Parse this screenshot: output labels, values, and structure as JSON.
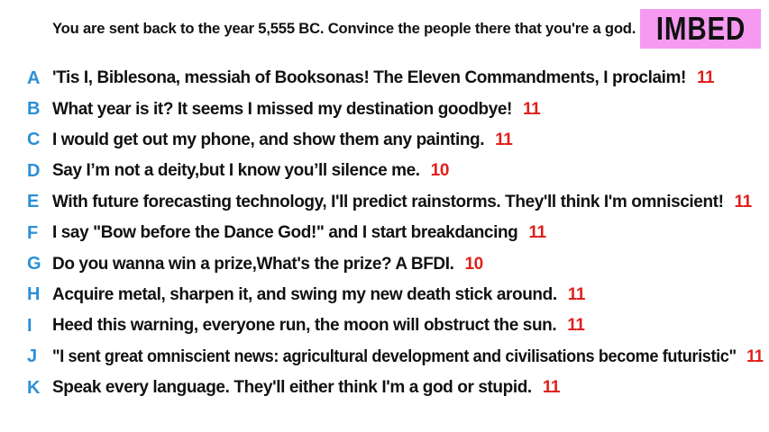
{
  "prompt": "You are sent back to the year 5,555 BC. Convince the people there that you're a god.",
  "logo": {
    "text": "IMBED",
    "background": "#f59af0"
  },
  "colors": {
    "letter": "#2c8fd6",
    "score": "#e0201b",
    "text": "#111111"
  },
  "answers": [
    {
      "letter": "A",
      "text": "'Tis I, Biblesona, messiah of Booksonas! The Eleven Commandments, I proclaim!",
      "score": "11"
    },
    {
      "letter": "B",
      "text": "What year is it? It seems I missed my destination goodbye!",
      "score": "11"
    },
    {
      "letter": "C",
      "text": "I would get out my phone, and show them any painting.",
      "score": "11"
    },
    {
      "letter": "D",
      "text": "Say I’m not a deity,but I know you’ll silence me.",
      "score": "10"
    },
    {
      "letter": "E",
      "text": "With future forecasting technology, I'll predict rainstorms. They'll think I'm omniscient!",
      "score": "11"
    },
    {
      "letter": "F",
      "text": "I say \"Bow before the Dance God!\" and I start breakdancing",
      "score": "11"
    },
    {
      "letter": "G",
      "text": "Do you wanna win a prize,What's the prize? A BFDI.",
      "score": "10"
    },
    {
      "letter": "H",
      "text": "Acquire metal, sharpen it, and swing my new death stick around.",
      "score": "11"
    },
    {
      "letter": "I",
      "text": "Heed this warning, everyone run, the moon will obstruct the sun.",
      "score": "11"
    },
    {
      "letter": "J",
      "text": "\"I sent great omniscient news: agricultural development and civilisations become futuristic\"",
      "score": "11"
    },
    {
      "letter": "K",
      "text": "Speak every language. They'll either think I'm a god or stupid.",
      "score": "11"
    }
  ]
}
